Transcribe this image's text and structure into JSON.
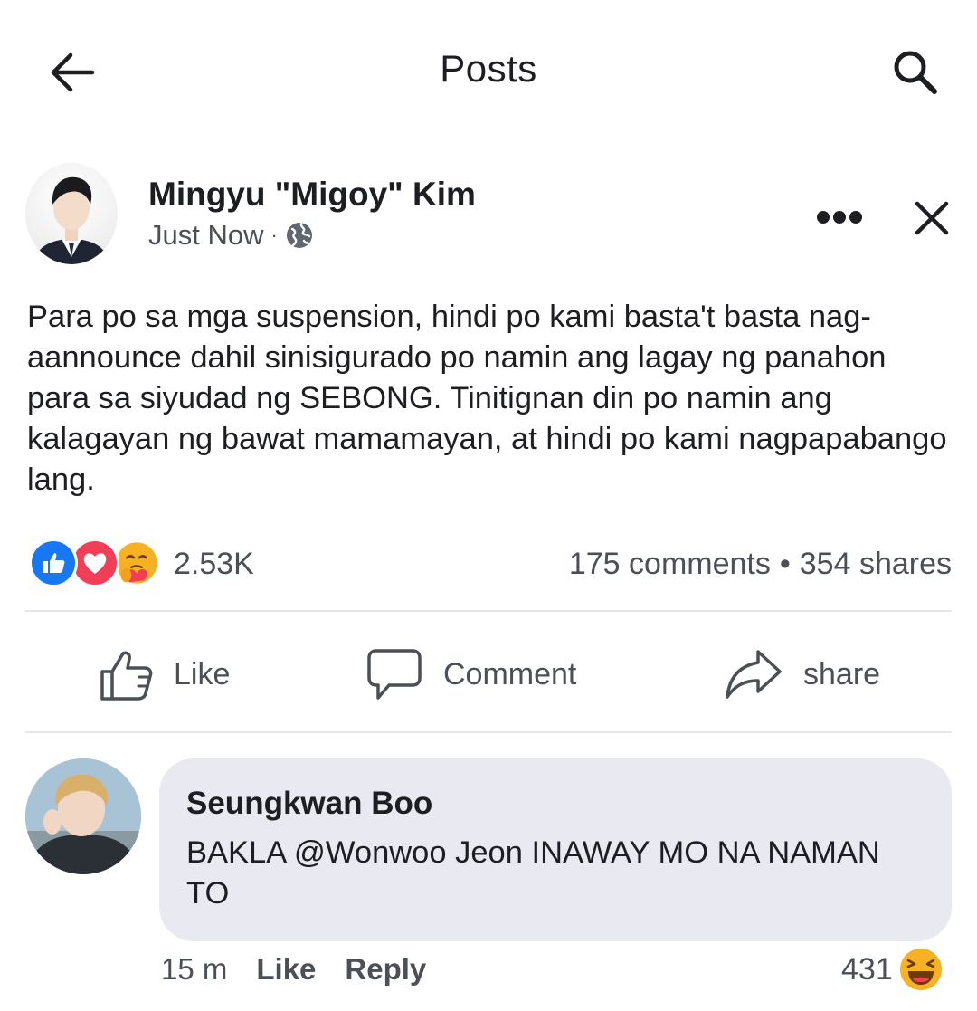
{
  "topbar": {
    "title": "Posts",
    "back_icon": "arrow-left-icon",
    "search_icon": "search-icon"
  },
  "post": {
    "author": "Mingyu \"Migoy\" Kim",
    "time": "Just Now",
    "meta_separator": "·",
    "privacy_icon": "globe-icon",
    "more_icon": "more-horizontal-icon",
    "close_icon": "close-icon",
    "body": "Para po sa mga suspension, hindi po kami basta't basta nag-aannounce dahil sinisigurado po namin ang lagay ng panahon para sa siyudad ng SEBONG. Tinitignan din po namin ang kalagayan ng bawat mamamayan, at hindi po kami nagpapabango lang."
  },
  "reactions": {
    "icons": [
      "like-reaction-icon",
      "love-reaction-icon",
      "care-reaction-icon"
    ],
    "count": "2.53K",
    "comments": "175 comments",
    "separator": "•",
    "shares": "354 shares"
  },
  "actions": {
    "like": "Like",
    "comment": "Comment",
    "share": "share"
  },
  "comment": {
    "author": "Seungkwan Boo",
    "text": "BAKLA @Wonwoo Jeon INAWAY MO NA NAMAN TO",
    "time": "15 m",
    "like": "Like",
    "reply": "Reply",
    "reaction_count": "431",
    "reaction_icon": "laughing-reaction-icon"
  },
  "colors": {
    "text_primary": "#1c1e21",
    "text_secondary": "#4b4f56",
    "like_blue": "#1877f2",
    "love_red": "#f33e58",
    "bubble": "#e9e9f2",
    "divider": "#e4e6eb"
  }
}
